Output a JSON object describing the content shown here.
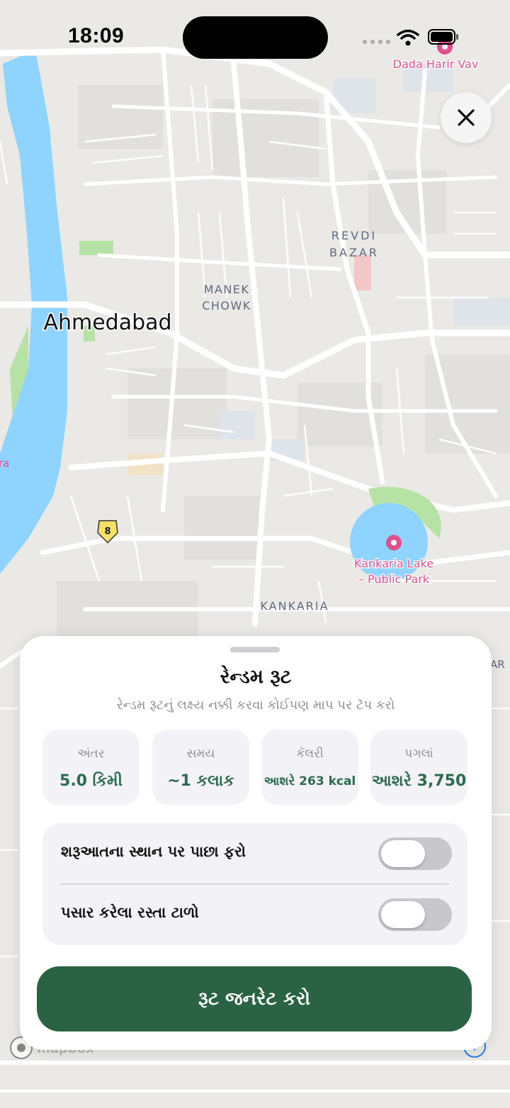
{
  "status_bar": {
    "time": "18:09"
  },
  "map": {
    "city_label": "Ahmedabad",
    "labels": {
      "dada_harir_vav": "Dada Harir Vav",
      "revdi": "REVDI",
      "bazar": "BAZAR",
      "manek": "MANEK",
      "chowk": "CHOWK",
      "kankaria_lake_1": "Kankaria Lake",
      "kankaria_lake_2": "– Public Park",
      "kankaria": "KANKARIA",
      "edge_left": "ra",
      "edge_right": "AR",
      "highway_shield": "8"
    },
    "colors": {
      "water": "#8fd3ff",
      "park": "#b6e3a5",
      "roads": "#ffffff",
      "poi_pink": "#e0508c"
    }
  },
  "sheet": {
    "title": "રેન્ડમ રૂટ",
    "subtitle": "રેન્ડમ રૂટનું લક્ષ્ય નક્કી કરવા કોઈપણ માપ પર ટૅપ કરો",
    "stats": [
      {
        "label": "અંતર",
        "value": "5.0 કિમી"
      },
      {
        "label": "સમય",
        "value": "~1 કલાક"
      },
      {
        "label": "કૅલરી",
        "value": "આશરે 263 kcal"
      },
      {
        "label": "પગલાં",
        "value": "આશરે 3,750"
      }
    ],
    "options": [
      {
        "label": "શરૂઆતના સ્થાન પર પાછા ફરો",
        "enabled": false
      },
      {
        "label": "પસાર કરેલા રસ્તા ટાળો",
        "enabled": false
      }
    ],
    "generate_button": "રૂટ જનરેટ કરો",
    "accent_color": "#2a6244"
  },
  "attribution": {
    "logo": "mapbox-logo",
    "info": "info-icon"
  }
}
